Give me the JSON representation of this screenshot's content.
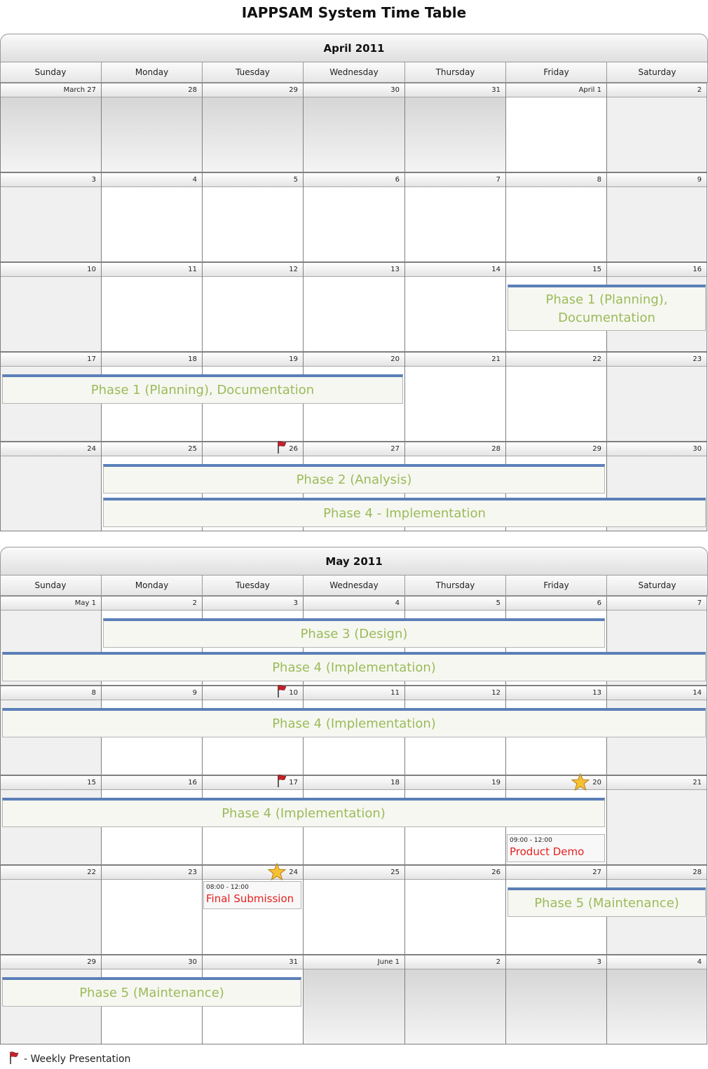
{
  "title": "IAPPSAM System Time Table",
  "weekdays": [
    "Sunday",
    "Monday",
    "Tuesday",
    "Wednesday",
    "Thursday",
    "Friday",
    "Saturday"
  ],
  "months": [
    {
      "name": "April 2011",
      "weeks": [
        [
          "March 27",
          "28",
          "29",
          "30",
          "31",
          "April 1",
          "2"
        ],
        [
          "3",
          "4",
          "5",
          "6",
          "7",
          "8",
          "9"
        ],
        [
          "10",
          "11",
          "12",
          "13",
          "14",
          "15",
          "16"
        ],
        [
          "17",
          "18",
          "19",
          "20",
          "21",
          "22",
          "23"
        ],
        [
          "24",
          "25",
          "26",
          "27",
          "28",
          "29",
          "30"
        ]
      ],
      "events": [
        {
          "week": 2,
          "start": 5,
          "span": 2,
          "lane": 0,
          "tall": true,
          "label": "Phase 1 (Planning), Documentation"
        },
        {
          "week": 3,
          "start": 0,
          "span": 4,
          "lane": 0,
          "label": "Phase 1 (Planning), Documentation"
        },
        {
          "week": 4,
          "start": 1,
          "span": 5,
          "lane": 0,
          "label": "Phase 2 (Analysis)"
        },
        {
          "week": 4,
          "start": 1,
          "span": 6,
          "lane": 1,
          "label": "Phase 4 - Implementation"
        }
      ],
      "flags": [
        {
          "week": 4,
          "day": 2
        }
      ],
      "stars": []
    },
    {
      "name": "May 2011",
      "weeks": [
        [
          "May 1",
          "2",
          "3",
          "4",
          "5",
          "6",
          "7"
        ],
        [
          "8",
          "9",
          "10",
          "11",
          "12",
          "13",
          "14"
        ],
        [
          "15",
          "16",
          "17",
          "18",
          "19",
          "20",
          "21"
        ],
        [
          "22",
          "23",
          "24",
          "25",
          "26",
          "27",
          "28"
        ],
        [
          "29",
          "30",
          "31",
          "June 1",
          "2",
          "3",
          "4"
        ]
      ],
      "events": [
        {
          "week": 0,
          "start": 1,
          "span": 5,
          "lane": 0,
          "label": "Phase 3 (Design)"
        },
        {
          "week": 0,
          "start": 0,
          "span": 7,
          "lane": 1,
          "label": "Phase 4 (Implementation)"
        },
        {
          "week": 1,
          "start": 0,
          "span": 7,
          "lane": 0,
          "label": "Phase 4 (Implementation)"
        },
        {
          "week": 2,
          "start": 0,
          "span": 6,
          "lane": 0,
          "label": "Phase 4 (Implementation)"
        },
        {
          "week": 3,
          "start": 5,
          "span": 2,
          "lane": 0,
          "label": "Phase 5 (Maintenance)"
        },
        {
          "week": 4,
          "start": 0,
          "span": 3,
          "lane": 0,
          "label": "Phase 5 (Maintenance)"
        }
      ],
      "appointments": [
        {
          "week": 2,
          "day": 5,
          "time": "09:00 - 12:00",
          "title": "Product Demo"
        },
        {
          "week": 3,
          "day": 2,
          "time": "08:00 - 12:00",
          "title": "Final Submission"
        }
      ],
      "flags": [
        {
          "week": 1,
          "day": 2
        },
        {
          "week": 2,
          "day": 2
        }
      ],
      "stars": [
        {
          "week": 2,
          "day": 5
        },
        {
          "week": 3,
          "day": 2
        }
      ]
    }
  ],
  "legend": {
    "icon": "flag-icon",
    "text": "- Weekly Presentation"
  },
  "colors": {
    "event_text": "#9bbb59",
    "event_bar": "#5b7fb8",
    "appointment_text": "#e81f1f"
  }
}
